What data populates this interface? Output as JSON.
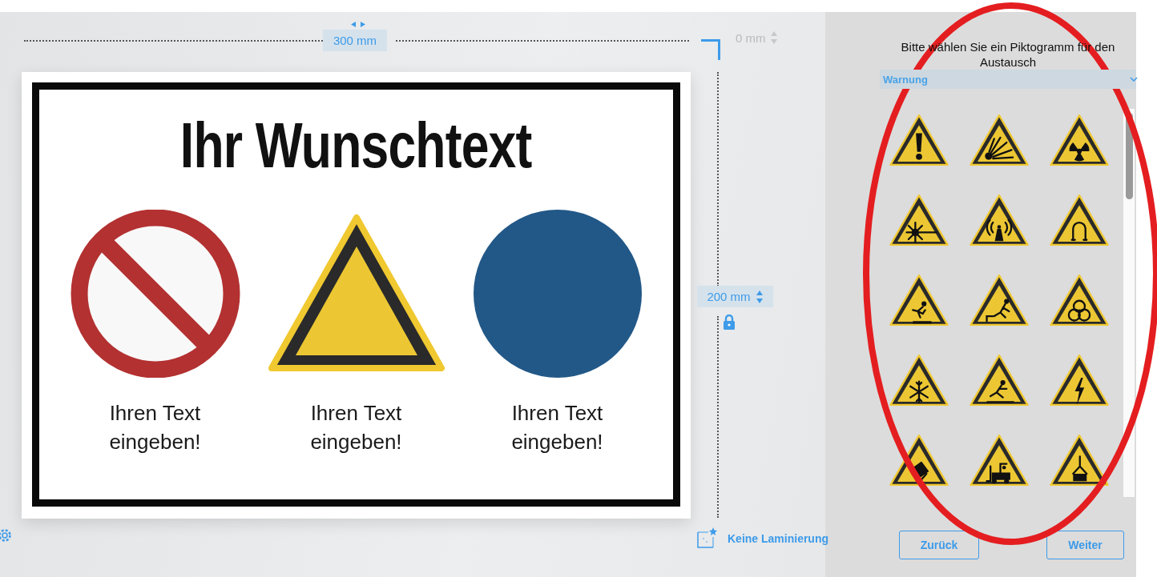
{
  "ruler": {
    "width": "300 mm",
    "offset": "0 mm",
    "height": "200 mm"
  },
  "sign": {
    "title": "Ihr Wunschtext",
    "symbols": [
      {
        "kind": "prohibition",
        "caption": "Ihren Text eingeben!"
      },
      {
        "kind": "warning",
        "caption": "Ihren Text eingeben!"
      },
      {
        "kind": "mandatory",
        "caption": "Ihren Text eingeben!"
      }
    ]
  },
  "lamination": {
    "label": "Keine Laminierung"
  },
  "panel": {
    "heading": "Bitte wählen Sie ein Piktogramm für den Austausch",
    "category": "Warnung",
    "pictograms": [
      {
        "kind": "exclamation"
      },
      {
        "kind": "explosion"
      },
      {
        "kind": "radiation"
      },
      {
        "kind": "laser"
      },
      {
        "kind": "radio"
      },
      {
        "kind": "magnet"
      },
      {
        "kind": "obstacle"
      },
      {
        "kind": "fall"
      },
      {
        "kind": "biohazard"
      },
      {
        "kind": "cold"
      },
      {
        "kind": "slip"
      },
      {
        "kind": "electric"
      },
      {
        "kind": "tipping"
      },
      {
        "kind": "forklift"
      },
      {
        "kind": "load"
      }
    ]
  },
  "buttons": [
    {
      "label": "Zurück"
    },
    {
      "label": "Weiter"
    }
  ]
}
